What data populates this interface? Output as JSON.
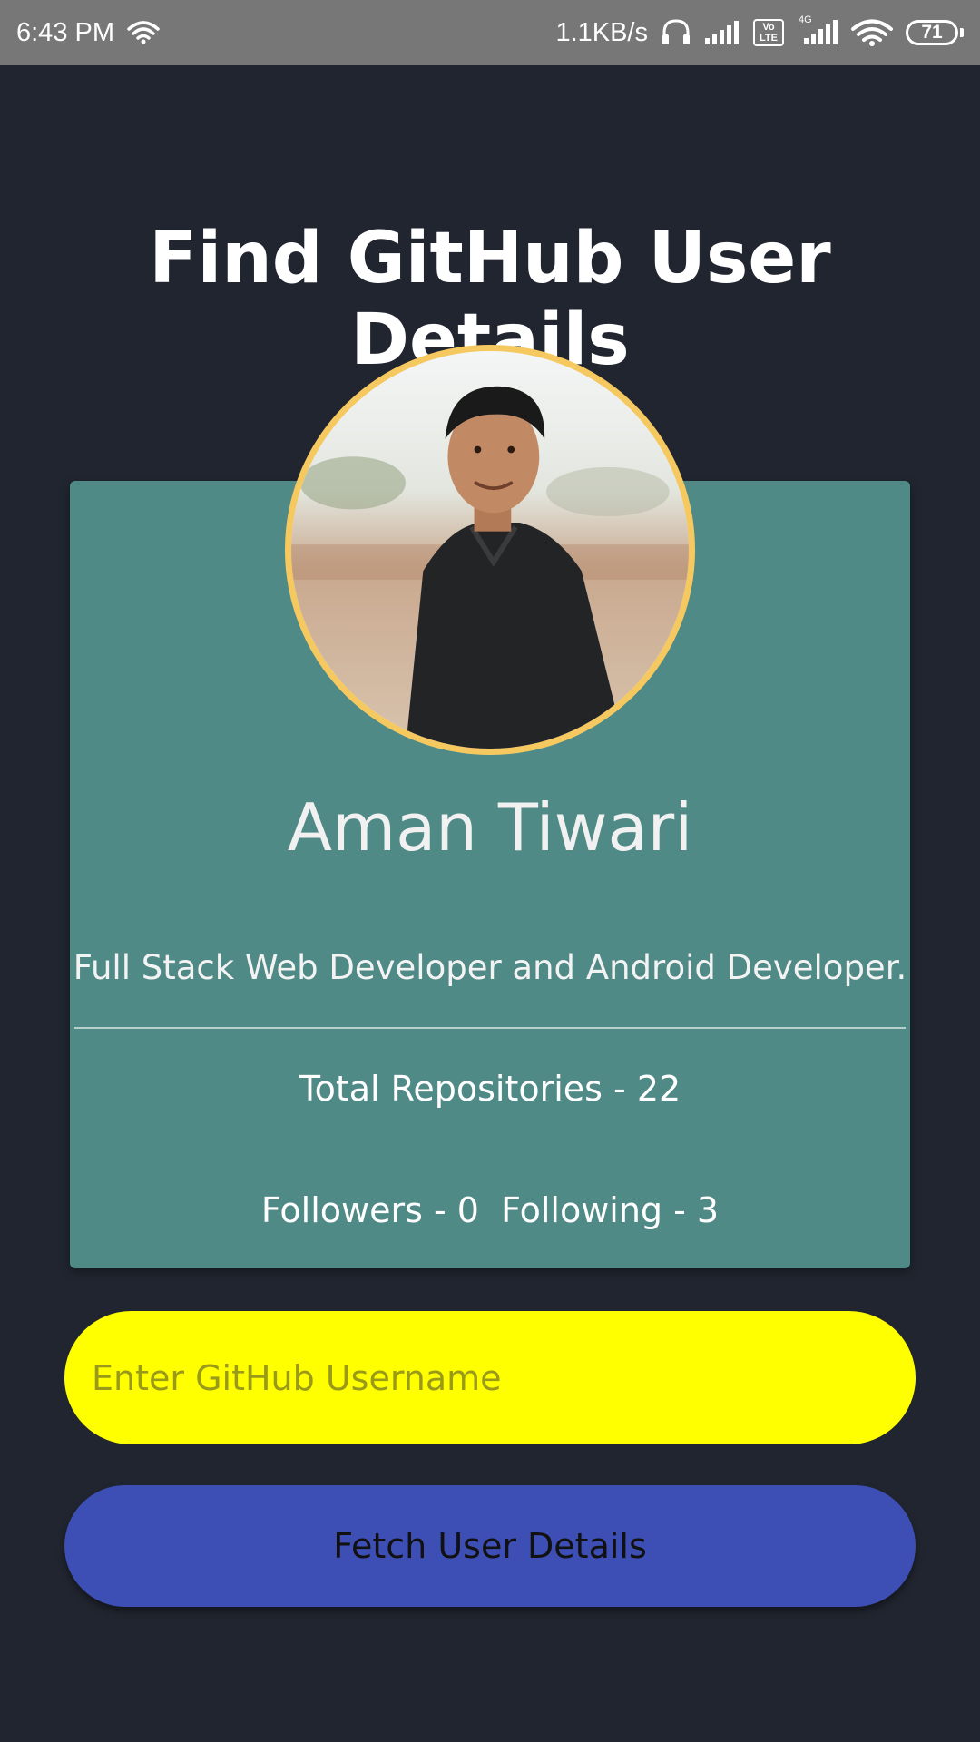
{
  "status_bar": {
    "time": "6:43 PM",
    "net_speed": "1.1KB/s",
    "volte_top": "Vo",
    "volte_bottom": "LTE",
    "network_type": "4G",
    "battery": "71",
    "icons": [
      "wifi-icon",
      "headset-icon",
      "signal-icon",
      "volte-icon",
      "signal-4g-icon",
      "wifi-icon",
      "battery-icon"
    ]
  },
  "page": {
    "title": "Find GitHub User Details"
  },
  "profile": {
    "avatar_icon": "profile-photo",
    "name": "Aman Tiwari",
    "bio": "Full Stack Web Developer and Android Developer.",
    "repos": "Total Repositories - 22",
    "follow": "Followers - 0  Following - 3"
  },
  "form": {
    "username_placeholder": "Enter GitHub Username",
    "username_value": "",
    "fetch_label": "Fetch User Details"
  },
  "colors": {
    "background": "#20252f",
    "status_bar": "#777777",
    "card": "#4f8a87",
    "avatar_border": "#f6c960",
    "input_bg": "#ffff00",
    "button_bg": "#3d4fb5"
  }
}
